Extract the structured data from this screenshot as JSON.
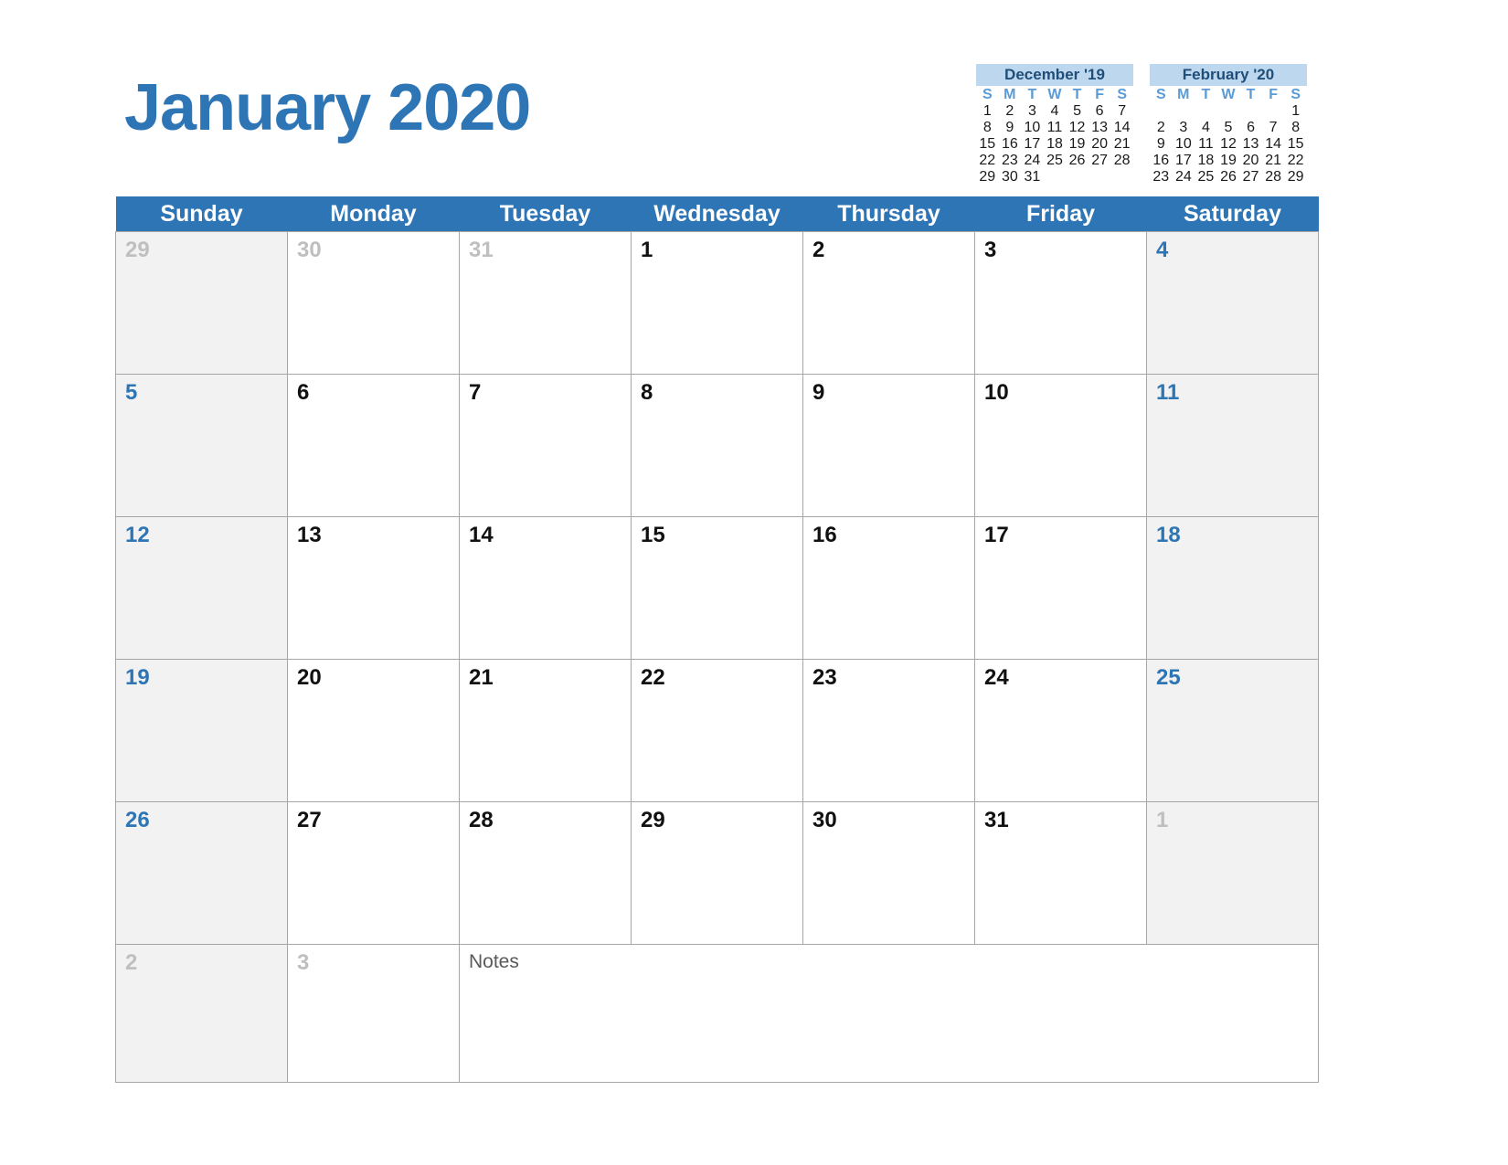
{
  "title": "January 2020",
  "colors": {
    "header_blue": "#2e75b6",
    "mini_header_blue": "#bdd7ee",
    "mini_header_text": "#1f4e79",
    "mini_dow": "#5b9bd5",
    "weekend_bg": "#f2f2f2",
    "out_month_text": "#bfbfbf",
    "grid_line": "#a6a6a6"
  },
  "mini_calendars": [
    {
      "name": "december-19",
      "title": "December '19",
      "dow": [
        "S",
        "M",
        "T",
        "W",
        "T",
        "F",
        "S"
      ],
      "weeks": [
        [
          "1",
          "2",
          "3",
          "4",
          "5",
          "6",
          "7"
        ],
        [
          "8",
          "9",
          "10",
          "11",
          "12",
          "13",
          "14"
        ],
        [
          "15",
          "16",
          "17",
          "18",
          "19",
          "20",
          "21"
        ],
        [
          "22",
          "23",
          "24",
          "25",
          "26",
          "27",
          "28"
        ],
        [
          "29",
          "30",
          "31",
          "",
          "",
          "",
          ""
        ]
      ]
    },
    {
      "name": "february-20",
      "title": "February '20",
      "dow": [
        "S",
        "M",
        "T",
        "W",
        "T",
        "F",
        "S"
      ],
      "weeks": [
        [
          "",
          "",
          "",
          "",
          "",
          "",
          "1"
        ],
        [
          "2",
          "3",
          "4",
          "5",
          "6",
          "7",
          "8"
        ],
        [
          "9",
          "10",
          "11",
          "12",
          "13",
          "14",
          "15"
        ],
        [
          "16",
          "17",
          "18",
          "19",
          "20",
          "21",
          "22"
        ],
        [
          "23",
          "24",
          "25",
          "26",
          "27",
          "28",
          "29"
        ]
      ]
    }
  ],
  "weekday_headers": [
    "Sunday",
    "Monday",
    "Tuesday",
    "Wednesday",
    "Thursday",
    "Friday",
    "Saturday"
  ],
  "weeks": [
    [
      {
        "num": "29",
        "in_month": false
      },
      {
        "num": "30",
        "in_month": false
      },
      {
        "num": "31",
        "in_month": false
      },
      {
        "num": "1",
        "in_month": true
      },
      {
        "num": "2",
        "in_month": true
      },
      {
        "num": "3",
        "in_month": true
      },
      {
        "num": "4",
        "in_month": true
      }
    ],
    [
      {
        "num": "5",
        "in_month": true
      },
      {
        "num": "6",
        "in_month": true
      },
      {
        "num": "7",
        "in_month": true
      },
      {
        "num": "8",
        "in_month": true
      },
      {
        "num": "9",
        "in_month": true
      },
      {
        "num": "10",
        "in_month": true
      },
      {
        "num": "11",
        "in_month": true
      }
    ],
    [
      {
        "num": "12",
        "in_month": true
      },
      {
        "num": "13",
        "in_month": true
      },
      {
        "num": "14",
        "in_month": true
      },
      {
        "num": "15",
        "in_month": true
      },
      {
        "num": "16",
        "in_month": true
      },
      {
        "num": "17",
        "in_month": true
      },
      {
        "num": "18",
        "in_month": true
      }
    ],
    [
      {
        "num": "19",
        "in_month": true
      },
      {
        "num": "20",
        "in_month": true
      },
      {
        "num": "21",
        "in_month": true
      },
      {
        "num": "22",
        "in_month": true
      },
      {
        "num": "23",
        "in_month": true
      },
      {
        "num": "24",
        "in_month": true
      },
      {
        "num": "25",
        "in_month": true
      }
    ],
    [
      {
        "num": "26",
        "in_month": true
      },
      {
        "num": "27",
        "in_month": true
      },
      {
        "num": "28",
        "in_month": true
      },
      {
        "num": "29",
        "in_month": true
      },
      {
        "num": "30",
        "in_month": true
      },
      {
        "num": "31",
        "in_month": true
      },
      {
        "num": "1",
        "in_month": false
      }
    ]
  ],
  "notes_row": {
    "sunday": {
      "num": "2",
      "in_month": false
    },
    "monday": {
      "num": "3",
      "in_month": false
    },
    "notes_label": "Notes"
  }
}
